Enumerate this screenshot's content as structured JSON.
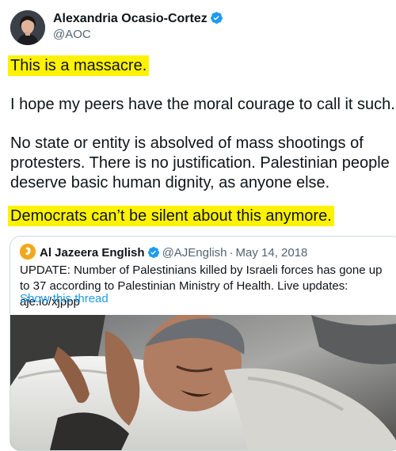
{
  "tweet": {
    "author_name": "Alexandria Ocasio-Cortez",
    "author_handle": "@AOC",
    "lines": [
      "This is a massacre.",
      "I hope my peers have the moral courage to call it such.",
      "No state or entity is absolved of mass shootings of",
      "protesters. There is no justification. Palestinian people",
      "deserve basic human dignity, as anyone else.",
      "Democrats can’t be silent about this anymore."
    ]
  },
  "quote": {
    "author_name": "Al Jazeera English",
    "author_handle": "@AJEnglish",
    "separator": "·",
    "date": "May 14, 2018",
    "text": "UPDATE: Number of Palestinians killed by Israeli forces has gone up to 37 according to Palestinian Ministry of Health. Live updates: aje.io/xjppp",
    "show_thread": "Show this thread"
  },
  "colors": {
    "highlight": "#fff200",
    "verified": "#1d9bf0",
    "link": "#1d9bf0"
  },
  "icons": {
    "verified": "verified-badge-icon",
    "aj_logo": "al-jazeera-logo-icon"
  }
}
